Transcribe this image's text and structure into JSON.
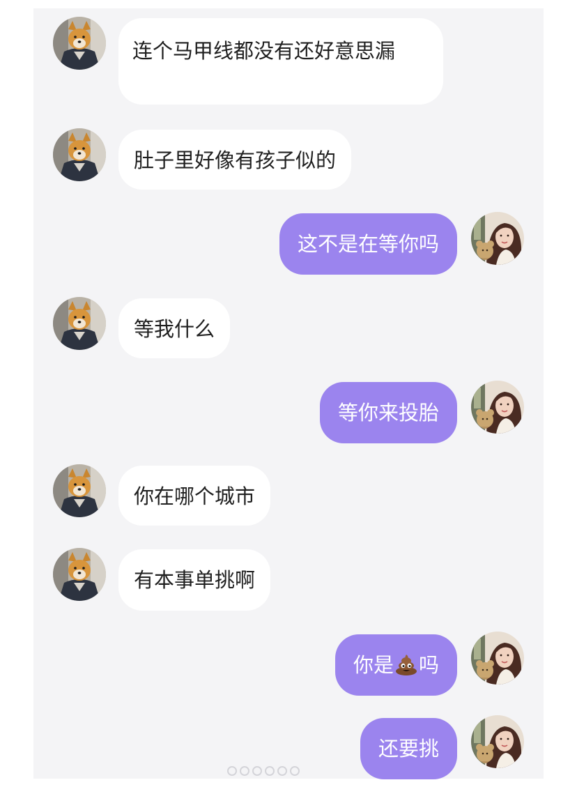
{
  "chat": {
    "messages": [
      {
        "from": "friend",
        "text": "连个马甲线都没有还好意思漏"
      },
      {
        "from": "friend",
        "text": "肚子里好像有孩子似的"
      },
      {
        "from": "me",
        "text": "这不是在等你吗"
      },
      {
        "from": "friend",
        "text": "等我什么"
      },
      {
        "from": "me",
        "text": "等你来投胎"
      },
      {
        "from": "friend",
        "text": "你在哪个城市"
      },
      {
        "from": "friend",
        "text": "有本事单挑啊"
      },
      {
        "from": "me",
        "text_before": "你是",
        "emoji": "poop-emoji",
        "text_after": "吗"
      },
      {
        "from": "me",
        "text": "还要挑"
      }
    ]
  },
  "colors": {
    "panel_background": "#f4f4f6",
    "incoming_bubble": "#ffffff",
    "outgoing_bubble": "#9b84ee",
    "outgoing_text": "#ffffff",
    "incoming_text": "#1f1f1f"
  },
  "icons": {
    "friend_avatar": "shiba-dog-avatar",
    "my_avatar": "girl-with-teddy-bear-avatar",
    "watermark": "weibo-watermark"
  }
}
